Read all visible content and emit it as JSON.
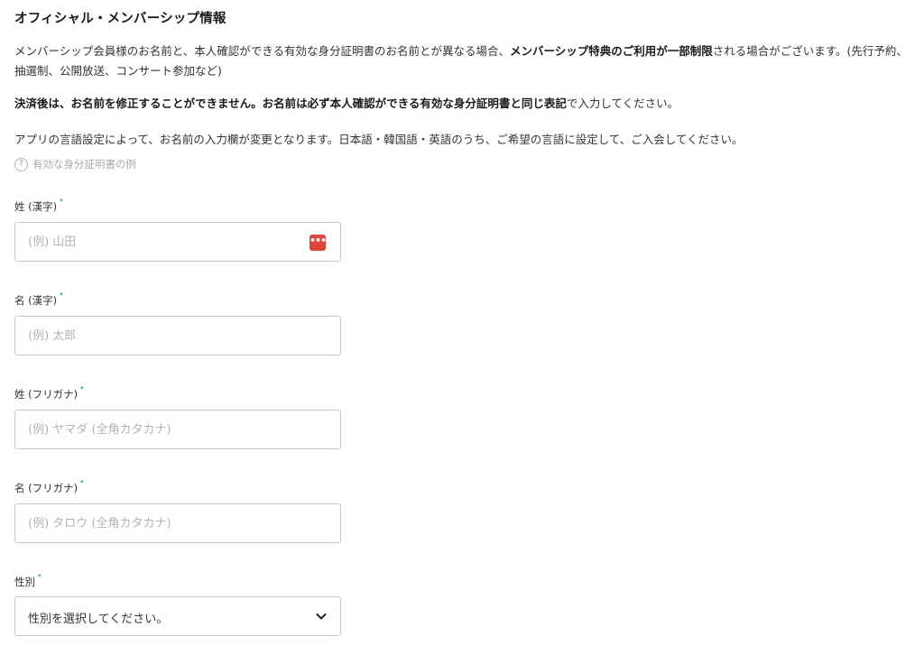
{
  "section": {
    "title": "オフィシャル・メンバーシップ情報"
  },
  "notice": {
    "p1_part1": "メンバーシップ会員様のお名前と、本人確認ができる有効な身分証明書のお名前とが異なる場合、",
    "p1_bold": "メンバーシップ特典のご利用が一部制限",
    "p1_part2": "される場合がございます。(先行予約、抽選制、公開放送、コンサート参加など)",
    "p2_bold": "決済後は、お名前を修正することができません。お名前は必ず本人確認ができる有効な身分証明書と同じ表記",
    "p2_rest": "で入力してください。",
    "p3": "アプリの言語設定によって、お名前の入力欄が変更となります。日本語・韓国語・英語のうち、ご希望の言語に設定して、ご入会してください。"
  },
  "help": {
    "icon": "question-circle-icon",
    "label": "有効な身分証明書の例"
  },
  "form": {
    "last_name_kanji": {
      "label": "姓 (漢字)",
      "placeholder": "(例) 山田",
      "value": ""
    },
    "first_name_kanji": {
      "label": "名 (漢字)",
      "placeholder": "(例) 太郎",
      "value": ""
    },
    "last_name_kana": {
      "label": "姓 (フリガナ)",
      "placeholder": "(例) ヤマダ (全角カタカナ)",
      "value": ""
    },
    "first_name_kana": {
      "label": "名 (フリガナ)",
      "placeholder": "(例) タロウ (全角カタカナ)",
      "value": ""
    },
    "gender": {
      "label": "性別",
      "selected": "性別を選択してください。"
    },
    "required_mark": "•"
  },
  "colors": {
    "required": "#10b9c8",
    "password_manager_icon": "#e0453a"
  },
  "icons": {
    "password_manager": "password-manager-icon",
    "dropdown": "chevron-down-icon"
  }
}
